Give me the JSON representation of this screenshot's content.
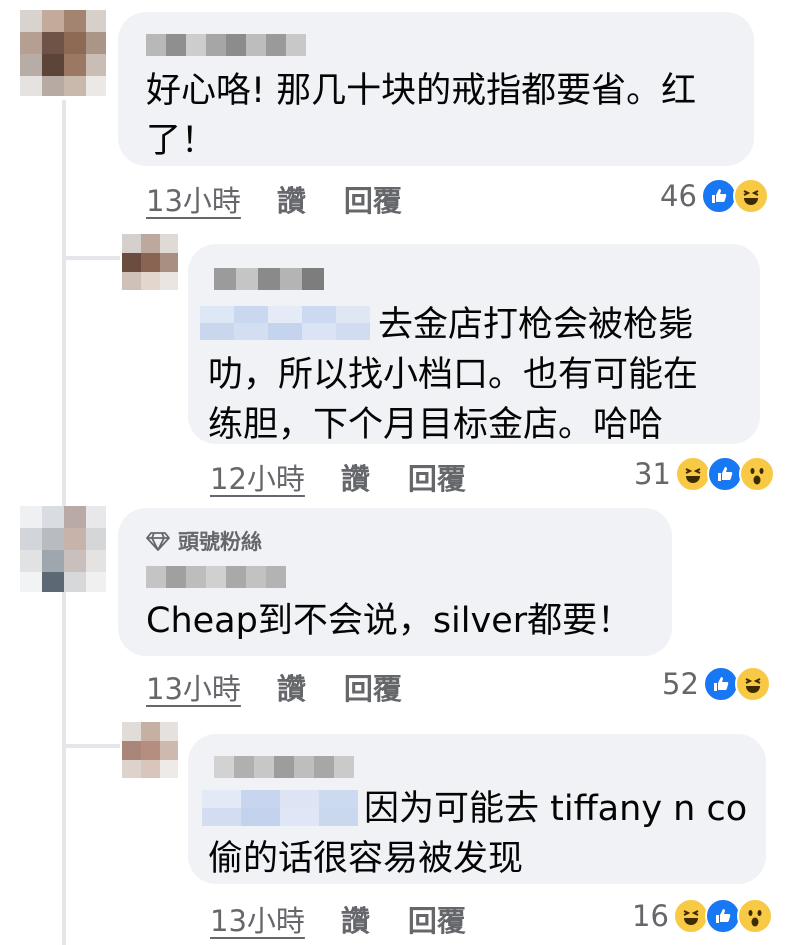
{
  "colors": {
    "bubble": "#f0f2f5",
    "meta": "#65676b",
    "like": "#1877f2",
    "emoji": "#f7c944"
  },
  "comments": [
    {
      "text": "好心咯! 那几十块的戒指都要省。红\n了！",
      "time": "13小時",
      "like_label": "讚",
      "reply_label": "回覆",
      "reaction_count": "46",
      "reactions": [
        "like-icon",
        "haha-icon"
      ]
    },
    {
      "text": "去金店打枪会被枪毙\n叻，所以找小档口。也有可能在\n练胆，下个月目标金店。哈哈",
      "time": "12小時",
      "like_label": "讚",
      "reply_label": "回覆",
      "reaction_count": "31",
      "reactions": [
        "haha-icon",
        "like-icon",
        "wow-icon"
      ]
    },
    {
      "badge": "頭號粉絲",
      "text": "Cheap到不会说，silver都要！",
      "time": "13小時",
      "like_label": "讚",
      "reply_label": "回覆",
      "reaction_count": "52",
      "reactions": [
        "like-icon",
        "haha-icon"
      ]
    },
    {
      "text": "因为可能去 tiffany n co\n偷的话很容易被发现",
      "time": "13小時",
      "like_label": "讚",
      "reply_label": "回覆",
      "reaction_count": "16",
      "reactions": [
        "haha-icon",
        "like-icon",
        "wow-icon"
      ]
    }
  ]
}
